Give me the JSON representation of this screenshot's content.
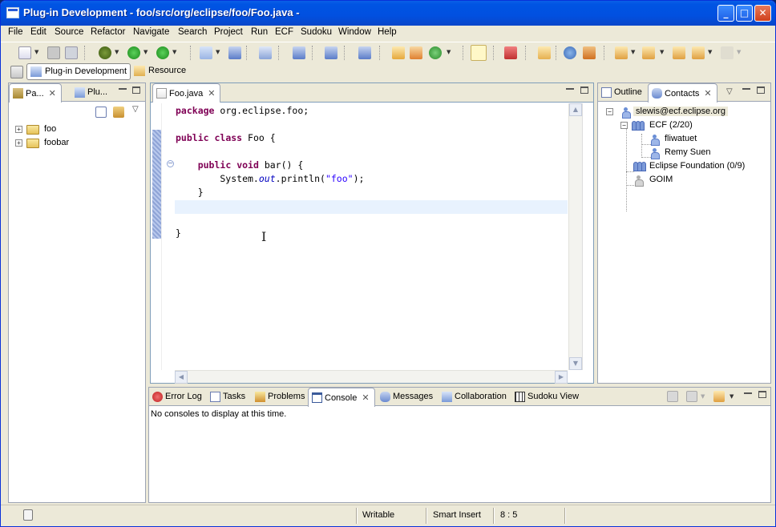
{
  "window": {
    "title": "Plug-in Development - foo/src/org/eclipse/foo/Foo.java -",
    "minimize": "_",
    "maximize": "□",
    "close": "✕"
  },
  "menu": [
    "File",
    "Edit",
    "Source",
    "Refactor",
    "Navigate",
    "Search",
    "Project",
    "Run",
    "ECF",
    "Sudoku",
    "Window",
    "Help"
  ],
  "perspectives": {
    "active": "Plug-in Development",
    "other": "Resource"
  },
  "left_panel": {
    "tabs": [
      {
        "label": "Pa...",
        "icon": "package-explorer-icon"
      },
      {
        "label": "Plu...",
        "icon": "plugins-icon"
      }
    ],
    "tree": [
      {
        "label": "foo",
        "expander": "+"
      },
      {
        "label": "foobar",
        "expander": "+"
      }
    ]
  },
  "editor": {
    "tab_label": "Foo.java",
    "close": "✕",
    "code_lines": [
      {
        "parts": [
          {
            "t": "package",
            "c": "kw"
          },
          {
            "t": " org.eclipse.foo;",
            "c": ""
          }
        ]
      },
      {
        "parts": []
      },
      {
        "parts": [
          {
            "t": "public",
            "c": "kw"
          },
          {
            "t": " ",
            "c": ""
          },
          {
            "t": "class",
            "c": "kw"
          },
          {
            "t": " Foo {",
            "c": ""
          }
        ]
      },
      {
        "parts": []
      },
      {
        "parts": [
          {
            "t": "    ",
            "c": ""
          },
          {
            "t": "public",
            "c": "kw"
          },
          {
            "t": " ",
            "c": ""
          },
          {
            "t": "void",
            "c": "kw"
          },
          {
            "t": " bar() {",
            "c": ""
          }
        ]
      },
      {
        "parts": [
          {
            "t": "        System.",
            "c": ""
          },
          {
            "t": "out",
            "c": "stat"
          },
          {
            "t": ".println(",
            "c": ""
          },
          {
            "t": "\"foo\"",
            "c": "str"
          },
          {
            "t": ");",
            "c": ""
          }
        ]
      },
      {
        "parts": [
          {
            "t": "    }",
            "c": ""
          }
        ]
      },
      {
        "parts": [],
        "current": true
      },
      {
        "parts": []
      },
      {
        "parts": [
          {
            "t": "}",
            "c": ""
          }
        ]
      }
    ],
    "fold_marker": "−"
  },
  "right_panel": {
    "tabs": [
      {
        "label": "Outline",
        "icon": "outline-icon"
      },
      {
        "label": "Contacts",
        "icon": "contacts-icon"
      }
    ],
    "close": "✕",
    "root": {
      "label": "slewis@ecf.eclipse.org",
      "expander": "−"
    },
    "groups": [
      {
        "label": "ECF (2/20)",
        "expander": "−",
        "members": [
          {
            "label": "fliwatuet"
          },
          {
            "label": "Remy Suen"
          }
        ]
      },
      {
        "label": "Eclipse Foundation (0/9)"
      }
    ],
    "offline_entry": {
      "label": "GOIM"
    }
  },
  "bottom_panel": {
    "tabs": [
      {
        "label": "Error Log",
        "icon": "error-log-icon"
      },
      {
        "label": "Tasks",
        "icon": "tasks-icon"
      },
      {
        "label": "Problems",
        "icon": "problems-icon"
      },
      {
        "label": "Console",
        "icon": "console-icon",
        "active": true
      },
      {
        "label": "Messages",
        "icon": "messages-icon"
      },
      {
        "label": "Collaboration",
        "icon": "collaboration-icon"
      },
      {
        "label": "Sudoku View",
        "icon": "sudoku-icon"
      }
    ],
    "close": "✕",
    "message": "No consoles to display at this time."
  },
  "status": {
    "mode": "Writable",
    "insert": "Smart Insert",
    "position": "8 : 5"
  },
  "colors": {
    "keyword": "#7f0055",
    "string": "#2a00ff",
    "static_field": "#0000c0",
    "current_line": "#e8f2fe",
    "titlebar": "#0054e3"
  }
}
